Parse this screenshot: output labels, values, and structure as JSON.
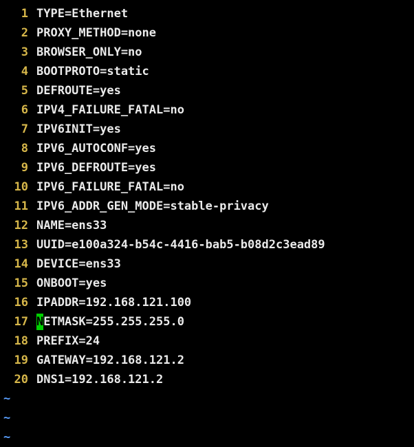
{
  "editor": {
    "lines": [
      {
        "num": "1",
        "text": "TYPE=Ethernet"
      },
      {
        "num": "2",
        "text": "PROXY_METHOD=none"
      },
      {
        "num": "3",
        "text": "BROWSER_ONLY=no"
      },
      {
        "num": "4",
        "text": "BOOTPROTO=static"
      },
      {
        "num": "5",
        "text": "DEFROUTE=yes"
      },
      {
        "num": "6",
        "text": "IPV4_FAILURE_FATAL=no"
      },
      {
        "num": "7",
        "text": "IPV6INIT=yes"
      },
      {
        "num": "8",
        "text": "IPV6_AUTOCONF=yes"
      },
      {
        "num": "9",
        "text": "IPV6_DEFROUTE=yes"
      },
      {
        "num": "10",
        "text": "IPV6_FAILURE_FATAL=no"
      },
      {
        "num": "11",
        "text": "IPV6_ADDR_GEN_MODE=stable-privacy"
      },
      {
        "num": "12",
        "text": "NAME=ens33"
      },
      {
        "num": "13",
        "text": "UUID=e100a324-b54c-4416-bab5-b08d2c3ead89"
      },
      {
        "num": "14",
        "text": "DEVICE=ens33"
      },
      {
        "num": "15",
        "text": "ONBOOT=yes"
      },
      {
        "num": "16",
        "text": "IPADDR=192.168.121.100"
      },
      {
        "num": "17",
        "cursor_char": "N",
        "text": "ETMASK=255.255.255.0"
      },
      {
        "num": "18",
        "text": "PREFIX=24"
      },
      {
        "num": "19",
        "text": "GATEWAY=192.168.121.2"
      },
      {
        "num": "20",
        "text": "DNS1=192.168.121.2"
      }
    ],
    "tilde": "~",
    "colors": {
      "background": "#000000",
      "line_number": "#d7b74a",
      "text": "#eaeaea",
      "cursor": "#00d000",
      "tilde": "#5aa0ff"
    }
  }
}
